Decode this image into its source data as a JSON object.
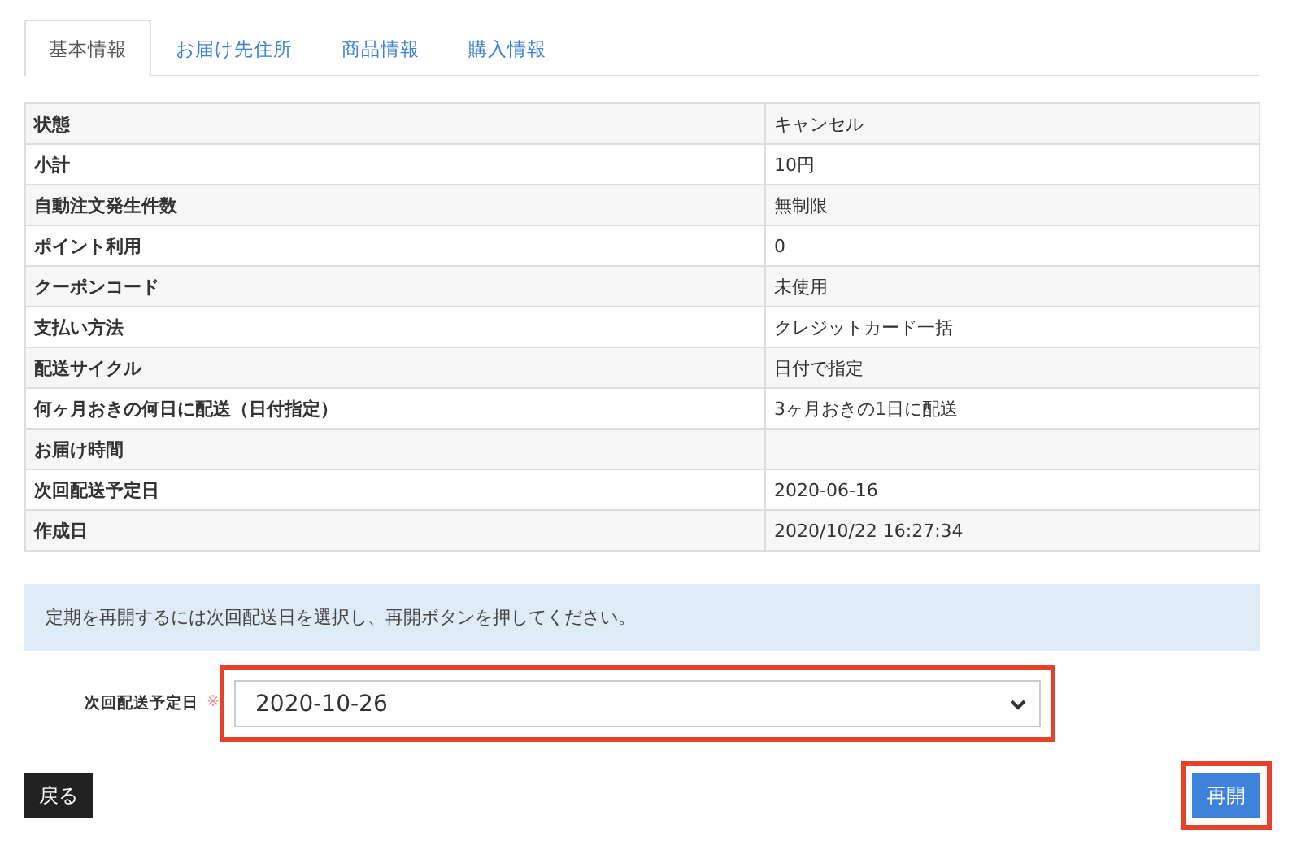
{
  "tabs": [
    {
      "label": "基本情報",
      "selected": true
    },
    {
      "label": "お届け先住所",
      "selected": false
    },
    {
      "label": "商品情報",
      "selected": false
    },
    {
      "label": "購入情報",
      "selected": false
    }
  ],
  "details": [
    {
      "label": "状態",
      "value": "キャンセル"
    },
    {
      "label": "小計",
      "value": "10円"
    },
    {
      "label": "自動注文発生件数",
      "value": "無制限"
    },
    {
      "label": "ポイント利用",
      "value": "0"
    },
    {
      "label": "クーポンコード",
      "value": "未使用"
    },
    {
      "label": "支払い方法",
      "value": "クレジットカード一括"
    },
    {
      "label": "配送サイクル",
      "value": "日付で指定"
    },
    {
      "label": "何ヶ月おきの何日に配送（日付指定）",
      "value": "3ヶ月おきの1日に配送"
    },
    {
      "label": "お届け時間"
    },
    {
      "label": "次回配送予定日",
      "value": "2020-06-16"
    },
    {
      "label": "作成日",
      "value": "2020/10/22 16:27:34"
    }
  ],
  "notice": "定期を再開するには次回配送日を選択し、再開ボタンを押してください。",
  "form": {
    "label": "次回配送予定日",
    "required_mark": "※",
    "value": "2020-10-26",
    "highlighted": true
  },
  "buttons": {
    "back": {
      "label": "戻る"
    },
    "resume": {
      "label": "再開",
      "highlighted": true
    }
  }
}
